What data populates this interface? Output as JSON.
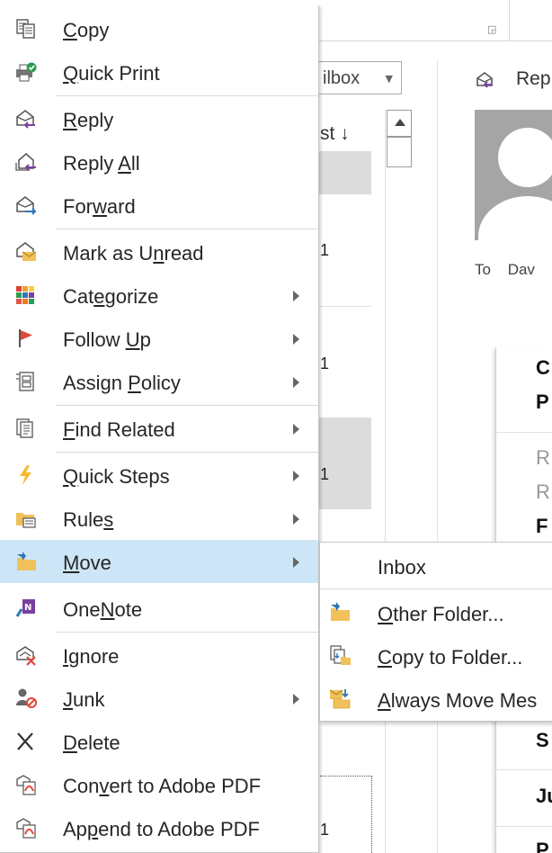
{
  "background": {
    "mailbox_selector": "ilbox",
    "sort_label": "st ↓",
    "list_digit": "1",
    "reply_label": "Rep",
    "to_label": "To",
    "to_name": "Dav",
    "preview_letters": [
      "C",
      "P",
      "R",
      "R",
      "F",
      "S",
      "Ju",
      "P"
    ]
  },
  "context_menu": {
    "items": [
      {
        "label": "Copy",
        "icon": "copy-icon",
        "has_submenu": false
      },
      {
        "label": "Quick Print",
        "icon": "quick-print-icon",
        "has_submenu": false
      },
      {
        "label": "Reply",
        "icon": "reply-icon",
        "has_submenu": false
      },
      {
        "label": "Reply All",
        "icon": "reply-all-icon",
        "has_submenu": false
      },
      {
        "label": "Forward",
        "icon": "forward-icon",
        "has_submenu": false
      },
      {
        "label": "Mark as Unread",
        "icon": "mark-unread-icon",
        "has_submenu": false
      },
      {
        "label": "Categorize",
        "icon": "categorize-icon",
        "has_submenu": true
      },
      {
        "label": "Follow Up",
        "icon": "follow-up-flag-icon",
        "has_submenu": true
      },
      {
        "label": "Assign Policy",
        "icon": "assign-policy-icon",
        "has_submenu": true
      },
      {
        "label": "Find Related",
        "icon": "find-related-icon",
        "has_submenu": true
      },
      {
        "label": "Quick Steps",
        "icon": "quick-steps-icon",
        "has_submenu": true
      },
      {
        "label": "Rules",
        "icon": "rules-icon",
        "has_submenu": true
      },
      {
        "label": "Move",
        "icon": "move-folder-icon",
        "has_submenu": true,
        "highlighted": true
      },
      {
        "label": "OneNote",
        "icon": "onenote-icon",
        "has_submenu": false
      },
      {
        "label": "Ignore",
        "icon": "ignore-icon",
        "has_submenu": false
      },
      {
        "label": "Junk",
        "icon": "junk-icon",
        "has_submenu": true
      },
      {
        "label": "Delete",
        "icon": "delete-icon",
        "has_submenu": false
      },
      {
        "label": "Convert to Adobe PDF",
        "icon": "convert-pdf-icon",
        "has_submenu": false
      },
      {
        "label": "Append to Adobe PDF",
        "icon": "append-pdf-icon",
        "has_submenu": false
      }
    ]
  },
  "move_submenu": {
    "items": [
      {
        "label": "Inbox"
      },
      {
        "label": "Other Folder...",
        "icon": "other-folder-icon"
      },
      {
        "label": "Copy to Folder...",
        "icon": "copy-to-folder-icon"
      },
      {
        "label": "Always Move Mes",
        "icon": "always-move-icon"
      }
    ]
  },
  "colors": {
    "highlight": "#cde6f7",
    "accent_blue": "#2e75b6",
    "flag_red": "#e0463a",
    "folder_yellow": "#f0c15a",
    "onenote_purple": "#7a3fa0"
  }
}
